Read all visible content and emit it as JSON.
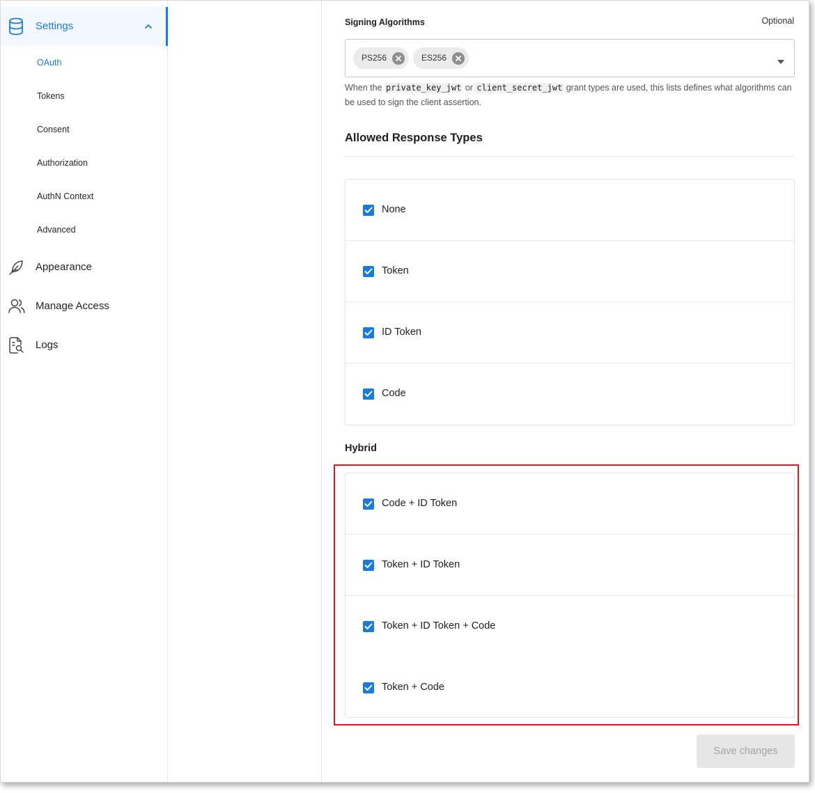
{
  "sidebar": {
    "settings": {
      "label": "Settings",
      "icon": "database-icon",
      "expanded": true
    },
    "sub_items": [
      {
        "label": "OAuth",
        "active": true
      },
      {
        "label": "Tokens",
        "active": false
      },
      {
        "label": "Consent",
        "active": false
      },
      {
        "label": "Authorization",
        "active": false
      },
      {
        "label": "AuthN Context",
        "active": false
      },
      {
        "label": "Advanced",
        "active": false
      }
    ],
    "items": [
      {
        "label": "Appearance",
        "icon": "feather-icon"
      },
      {
        "label": "Manage Access",
        "icon": "users-icon"
      },
      {
        "label": "Logs",
        "icon": "document-search-icon"
      }
    ],
    "accent_color": "#1a7cd9"
  },
  "signing": {
    "label": "Signing Algorithms",
    "optional": "Optional",
    "chips": [
      "PS256",
      "ES256"
    ],
    "help": {
      "prefix": "When the ",
      "code1": "private_key_jwt",
      "mid": " or ",
      "code2": "client_secret_jwt",
      "suffix": " grant types are used, this lists defines what algorithms can be used to sign the client assertion."
    }
  },
  "response_types": {
    "title": "Allowed Response Types",
    "options": [
      {
        "label": "None",
        "checked": true
      },
      {
        "label": "Token",
        "checked": true
      },
      {
        "label": "ID Token",
        "checked": true
      },
      {
        "label": "Code",
        "checked": true
      }
    ]
  },
  "hybrid": {
    "title": "Hybrid",
    "options": [
      {
        "label": "Code + ID Token",
        "checked": true
      },
      {
        "label": "Token + ID Token",
        "checked": true
      },
      {
        "label": "Token + ID Token + Code",
        "checked": true
      },
      {
        "label": "Token + Code",
        "checked": true
      }
    ],
    "highlight_color": "#e01616"
  },
  "footer": {
    "save_label": "Save changes",
    "disabled": true
  }
}
